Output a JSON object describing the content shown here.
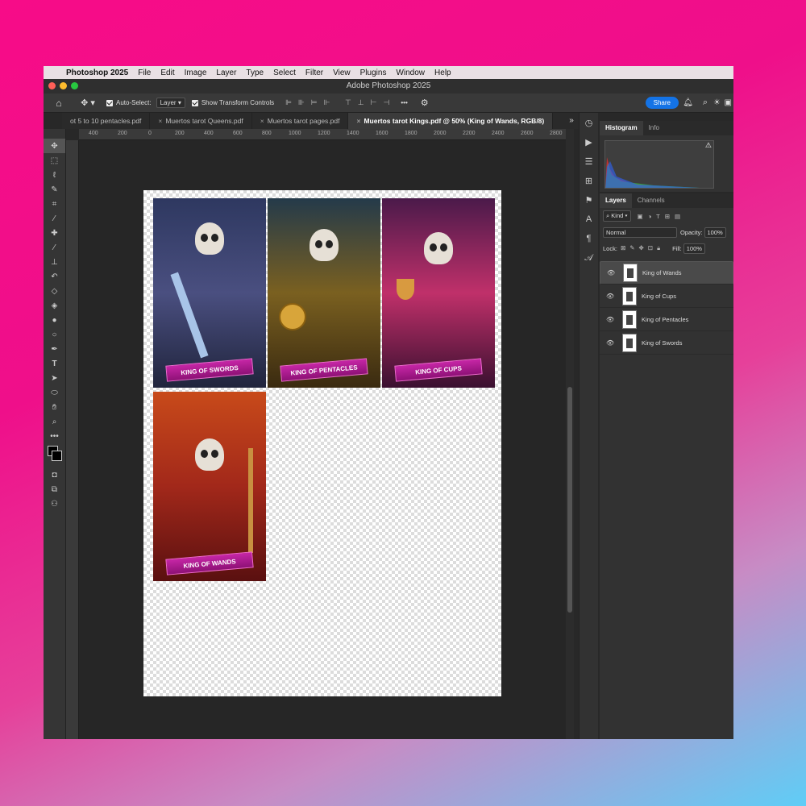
{
  "menubar": {
    "apple": "",
    "app": "Photoshop 2025",
    "items": [
      "File",
      "Edit",
      "Image",
      "Layer",
      "Type",
      "Select",
      "Filter",
      "View",
      "Plugins",
      "Window",
      "Help"
    ]
  },
  "window": {
    "title": "Adobe Photoshop 2025"
  },
  "options": {
    "auto_select_label": "Auto-Select:",
    "auto_select_value": "Layer",
    "show_transform_label": "Show Transform Controls",
    "more": "•••",
    "share_label": "Share"
  },
  "tabs": [
    {
      "label": "ot 5 to 10 pentacles.pdf",
      "active": false
    },
    {
      "label": "Muertos tarot Queens.pdf",
      "active": false
    },
    {
      "label": "Muertos tarot pages.pdf",
      "active": false
    },
    {
      "label": "Muertos tarot Kings.pdf @ 50% (King of Wands, RGB/8)",
      "active": true
    }
  ],
  "tab_overflow": "»",
  "ruler": {
    "ticks": [
      "400",
      "200",
      "0",
      "200",
      "400",
      "600",
      "800",
      "1000",
      "1200",
      "1400",
      "1600",
      "1800",
      "2000",
      "2200",
      "2400",
      "2600",
      "2800"
    ]
  },
  "cards": [
    {
      "label": "KING OF SWORDS",
      "color": "#3a4a7a"
    },
    {
      "label": "KING OF PENTACLES",
      "color": "#6b5a2a"
    },
    {
      "label": "KING OF CUPS",
      "color": "#b8306a"
    },
    {
      "label": "KING OF WANDS",
      "color": "#b0321a"
    }
  ],
  "panel_top": {
    "tabs": [
      "Histogram",
      "Info"
    ]
  },
  "panel_layers": {
    "tabs": [
      "Layers",
      "Channels"
    ],
    "kind": "Kind",
    "blend": "Normal",
    "opacity_label": "Opacity:",
    "opacity": "100%",
    "lock_label": "Lock:",
    "fill_label": "Fill:",
    "fill": "100%",
    "layers": [
      {
        "name": "King of Wands",
        "selected": true
      },
      {
        "name": "King of Cups",
        "selected": false
      },
      {
        "name": "King of Pentacles",
        "selected": false
      },
      {
        "name": "King of Swords",
        "selected": false
      }
    ]
  },
  "colors": {
    "accent": "#1473e6",
    "background_pink": "#f70c88"
  }
}
